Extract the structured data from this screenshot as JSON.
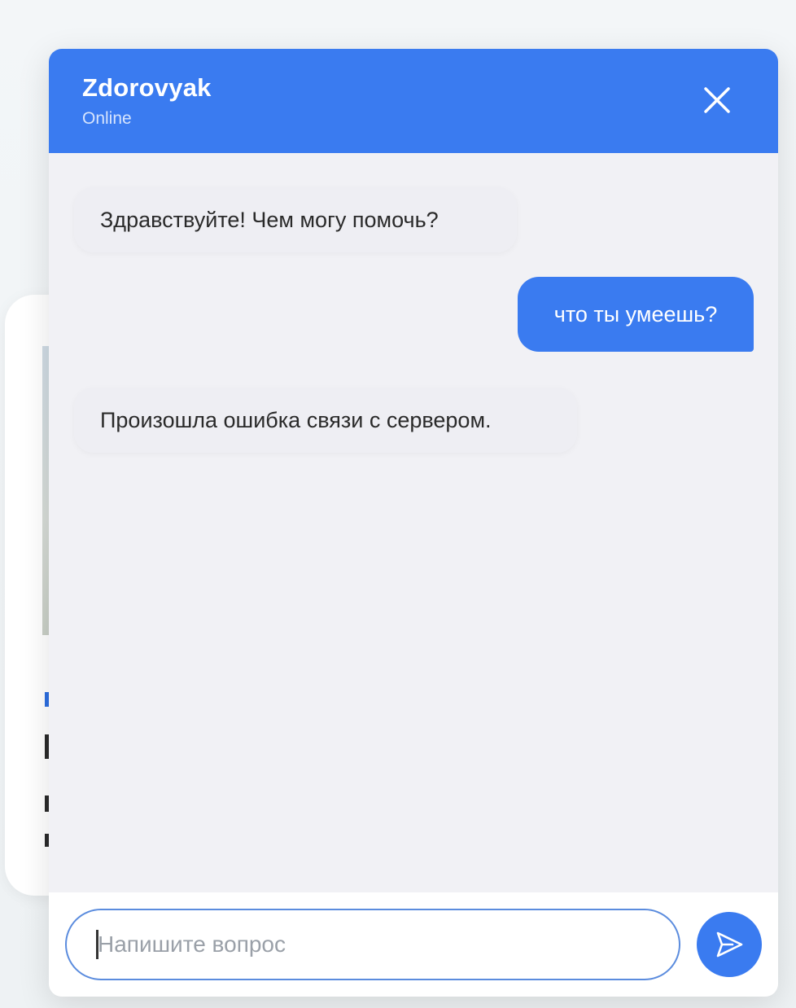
{
  "chat": {
    "title": "Zdorovyak",
    "status": "Online",
    "close_icon": "close-icon",
    "messages": [
      {
        "sender": "bot",
        "text": "Здравствуйте! Чем могу помочь?"
      },
      {
        "sender": "user",
        "text": "что ты умеешь?"
      },
      {
        "sender": "bot",
        "text": "Произошла ошибка связи с сервером."
      }
    ],
    "input": {
      "value": "",
      "placeholder": "Напишите вопрос"
    },
    "send_icon": "send-icon"
  },
  "colors": {
    "accent": "#3a7bf0",
    "chat_background": "#f1f1f5",
    "bot_bubble": "#eeeef3",
    "user_bubble": "#3a7bf0",
    "input_border": "#5b8cde"
  }
}
